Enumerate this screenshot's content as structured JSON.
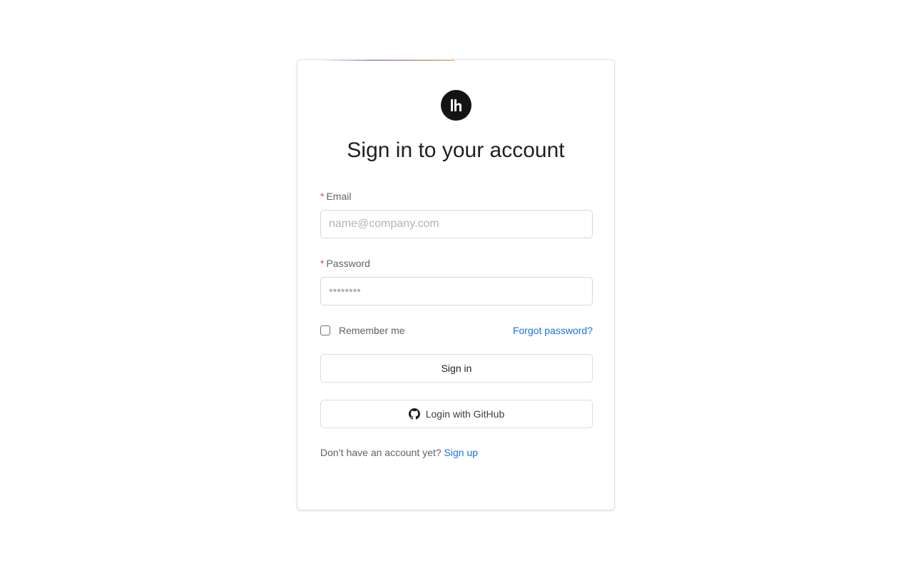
{
  "colors": {
    "accent_link": "#1a73e8",
    "required_star": "#e5484d",
    "logo_bg": "#141414",
    "gradient_start": "#8b5ad8",
    "gradient_end": "#e89a50"
  },
  "logo": {
    "icon": "brand-logo-icon"
  },
  "title": "Sign in to your account",
  "email": {
    "required_mark": "*",
    "label": "Email",
    "placeholder": "name@company.com",
    "value": ""
  },
  "password": {
    "required_mark": "*",
    "label": "Password",
    "placeholder": "••••••••",
    "value": ""
  },
  "remember_me": {
    "label": "Remember me",
    "checked": false
  },
  "forgot_password": "Forgot password?",
  "sign_in_button": "Sign in",
  "github_button": {
    "icon": "github-icon",
    "label": "Login with GitHub"
  },
  "signup": {
    "prompt": "Don’t have an account yet?",
    "link": "Sign up"
  }
}
